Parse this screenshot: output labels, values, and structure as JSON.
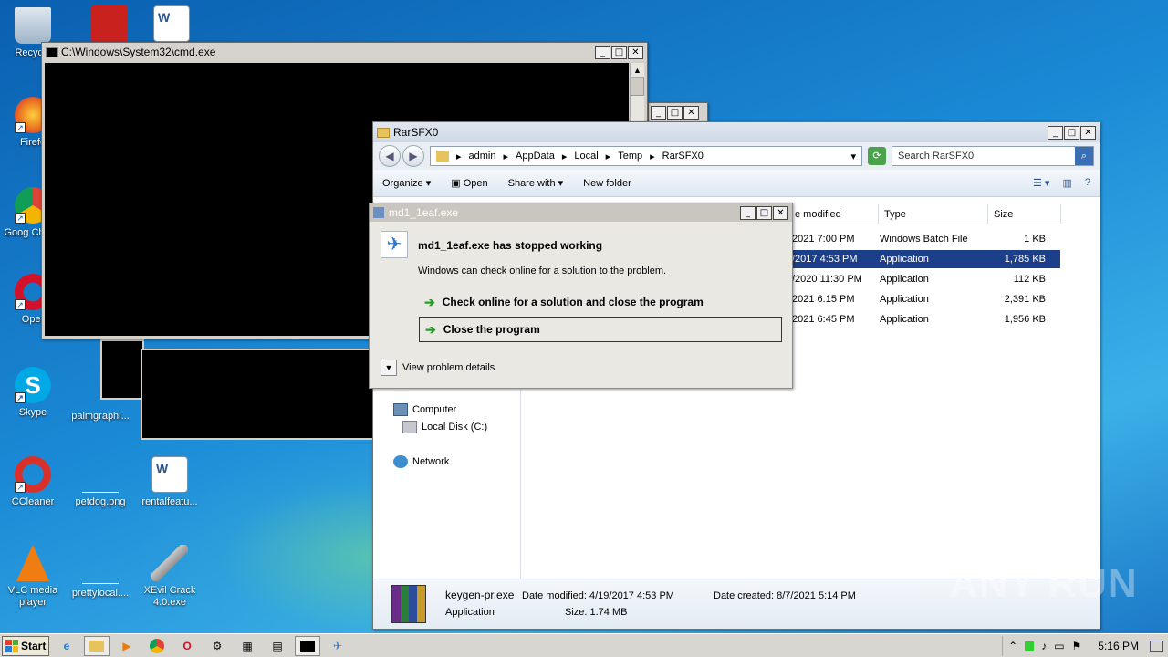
{
  "desktop": {
    "icons": [
      {
        "label": "Recycle",
        "name": "recycle-bin-icon",
        "color": "#9fb3c8"
      },
      {
        "label": "Firefo",
        "name": "firefox-icon",
        "color": "#e8661e"
      },
      {
        "label": "Goog Chrom",
        "name": "chrome-icon",
        "color": "#2fa84f"
      },
      {
        "label": "Oper",
        "name": "opera-icon",
        "color": "#d2112a"
      },
      {
        "label": "Skype",
        "name": "skype-icon",
        "color": "#00a8e6"
      },
      {
        "label": "CCleaner",
        "name": "ccleaner-icon",
        "color": "#d9302a"
      },
      {
        "label": "VLC media player",
        "name": "vlc-icon",
        "color": "#f07d12"
      },
      {
        "label": "palmgraphi...",
        "name": "file-icon",
        "color": "#ffffff"
      },
      {
        "label": "petdog.png",
        "name": "file-icon",
        "color": "#ffffff"
      },
      {
        "label": "prettylocal....",
        "name": "file-icon",
        "color": "#ffffff"
      },
      {
        "label": "rentalfeatu...",
        "name": "word-doc-icon",
        "color": "#2b5797"
      },
      {
        "label": "XEvil Crack 4.0.exe",
        "name": "key-icon",
        "color": "#b8b8b8"
      }
    ]
  },
  "cmd": {
    "title": "C:\\Windows\\System32\\cmd.exe"
  },
  "explorer": {
    "title": "RarSFX0",
    "breadcrumb": [
      "admin",
      "AppData",
      "Local",
      "Temp",
      "RarSFX0"
    ],
    "search_placeholder": "Search RarSFX0",
    "toolbar": {
      "organize": "Organize",
      "open": "Open",
      "share_with": "Share with",
      "new_folder": "New folder"
    },
    "columns": {
      "date_modified": "e modified",
      "type": "Type",
      "size": "Size"
    },
    "rows": [
      {
        "date": "2021 7:00 PM",
        "type": "Windows Batch File",
        "size": "1 KB"
      },
      {
        "date": "/2017 4:53 PM",
        "type": "Application",
        "size": "1,785 KB"
      },
      {
        "date": "/2020 11:30 PM",
        "type": "Application",
        "size": "112 KB"
      },
      {
        "date": "2021 6:15 PM",
        "type": "Application",
        "size": "2,391 KB"
      },
      {
        "date": "2021 6:45 PM",
        "type": "Application",
        "size": "1,956 KB"
      }
    ],
    "nav": {
      "computer": "Computer",
      "local_disk": "Local Disk (C:)",
      "network": "Network"
    },
    "details": {
      "filename": "keygen-pr.exe",
      "kind": "Application",
      "date_modified": "Date modified: 4/19/2017 4:53 PM",
      "size": "Size: 1.74 MB",
      "date_created": "Date created: 8/7/2021 5:14 PM"
    }
  },
  "crash_dialog": {
    "title": "md1_1eaf.exe",
    "heading": "md1_1eaf.exe has stopped working",
    "message": "Windows can check online for a solution to the problem.",
    "option_check": "Check online for a solution and close the program",
    "option_close": "Close the program",
    "details_toggle": "View problem details"
  },
  "taskbar": {
    "start": "Start",
    "clock": "5:16 PM"
  },
  "watermark": "ANY RUN"
}
